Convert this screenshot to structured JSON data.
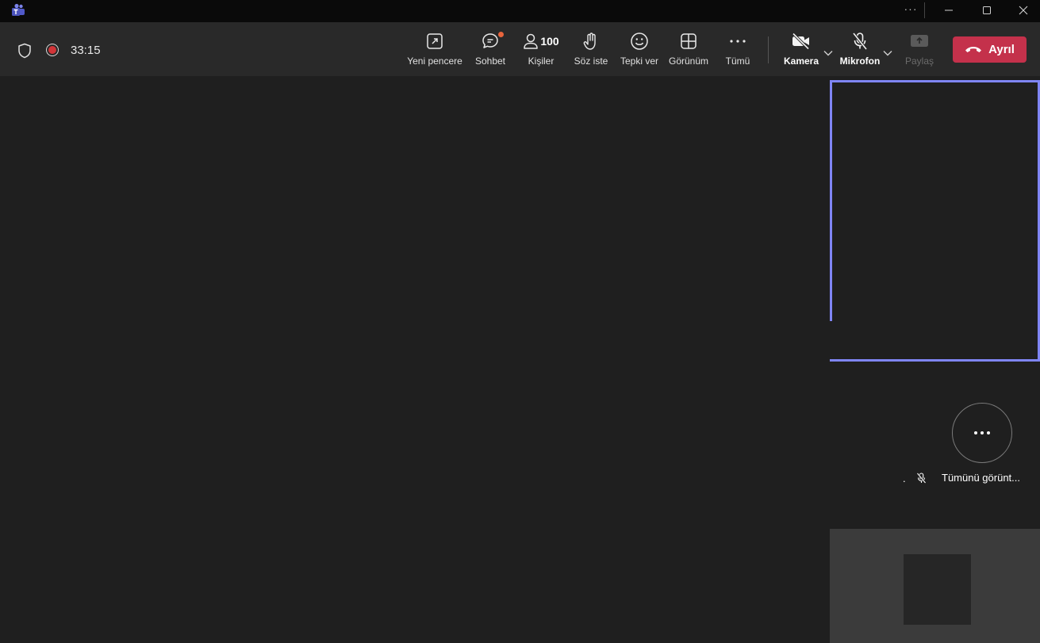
{
  "app": {
    "icon": "teams-icon"
  },
  "titlebar": {
    "more": "···"
  },
  "meeting": {
    "timer": "33:15"
  },
  "toolbar": {
    "new_window": "Yeni pencere",
    "chat": "Sohbet",
    "people": "Kişiler",
    "people_count": "100",
    "raise_hand": "Söz iste",
    "react": "Tepki ver",
    "view": "Görünüm",
    "more": "Tümü",
    "camera": "Kamera",
    "mic": "Mikrofon",
    "share": "Paylaş",
    "leave": "Ayrıl"
  },
  "colors": {
    "accent": "#7f85f5",
    "leave": "#c4314b",
    "chat_badge": "#e8643c",
    "record": "#d13438"
  },
  "gallery": {
    "participant_name": ".",
    "see_all": "Tümünü görünt..."
  }
}
